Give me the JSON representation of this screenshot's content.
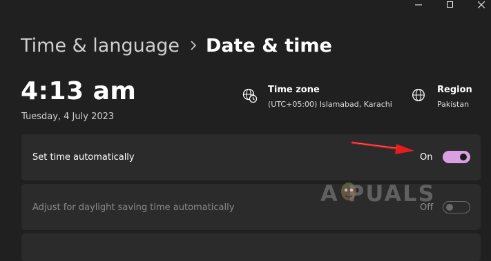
{
  "breadcrumb": {
    "parent": "Time & language",
    "current": "Date & time"
  },
  "clock": {
    "time": "4:13 am",
    "date": "Tuesday, 4 July 2023"
  },
  "time_zone": {
    "title": "Time zone",
    "value": "(UTC+05:00) Islamabad, Karachi",
    "icon": "globe-clock-icon"
  },
  "region": {
    "title": "Region",
    "value": "Pakistan",
    "icon": "globe-icon"
  },
  "settings": {
    "set_time_auto": {
      "label": "Set time automatically",
      "state": "On",
      "enabled": true
    },
    "daylight_saving": {
      "label": "Adjust for daylight saving time automatically",
      "state": "Off",
      "enabled": false
    }
  },
  "watermark": {
    "text": "A  PUALS"
  },
  "colors": {
    "background": "#202020",
    "card": "#2b2b2b",
    "accent": "#d99fe0",
    "annotation_arrow": "#e81c1c"
  }
}
